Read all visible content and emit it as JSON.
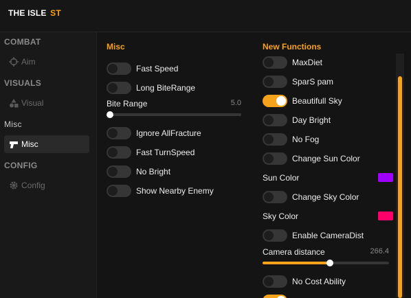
{
  "app": {
    "brand_main": "THE ISLE",
    "brand_accent": "ST"
  },
  "sidebar": {
    "combat": {
      "title": "COMBAT",
      "aim": "Aim"
    },
    "visuals": {
      "title": "VISUALS",
      "visual": "Visual"
    },
    "misc": {
      "title": "Misc",
      "misc": "Misc"
    },
    "config": {
      "title": "CONFIG",
      "config": "Config"
    }
  },
  "misc_panel": {
    "title": "Misc",
    "toggles": [
      {
        "label": "Fast Speed",
        "on": false
      },
      {
        "label": "Long BiteRange",
        "on": false
      },
      {
        "label": "Ignore AllFracture",
        "on": false
      },
      {
        "label": "Fast TurnSpeed",
        "on": false
      },
      {
        "label": "No Bright",
        "on": false
      },
      {
        "label": "Show Nearby Enemy",
        "on": false
      }
    ],
    "bite_range": {
      "label": "Bite Range",
      "value": "5.0",
      "fraction": 0.0
    }
  },
  "functions_panel": {
    "title": "New Functions",
    "toggles": [
      {
        "label": "MaxDiet",
        "on": false
      },
      {
        "label": "SparS pam",
        "on": false
      },
      {
        "label": "Beautifull Sky",
        "on": true
      },
      {
        "label": "Day Bright",
        "on": false
      },
      {
        "label": "No Fog",
        "on": false
      },
      {
        "label": "Change Sun Color",
        "on": false
      },
      {
        "label": "Change Sky Color",
        "on": false
      },
      {
        "label": "Enable CameraDist",
        "on": false
      },
      {
        "label": "No Cost Ability",
        "on": false
      },
      {
        "label": "",
        "on": true
      }
    ],
    "sun_color": {
      "label": "Sun Color",
      "color": "#a000ff"
    },
    "sky_color": {
      "label": "Sky Color",
      "color": "#ff006a"
    },
    "camera_distance": {
      "label": "Camera distance",
      "value": "266.4",
      "fraction": 0.53
    }
  },
  "colors": {
    "accent": "#f7a21b",
    "background": "#141414",
    "sidebar": "#191919"
  }
}
